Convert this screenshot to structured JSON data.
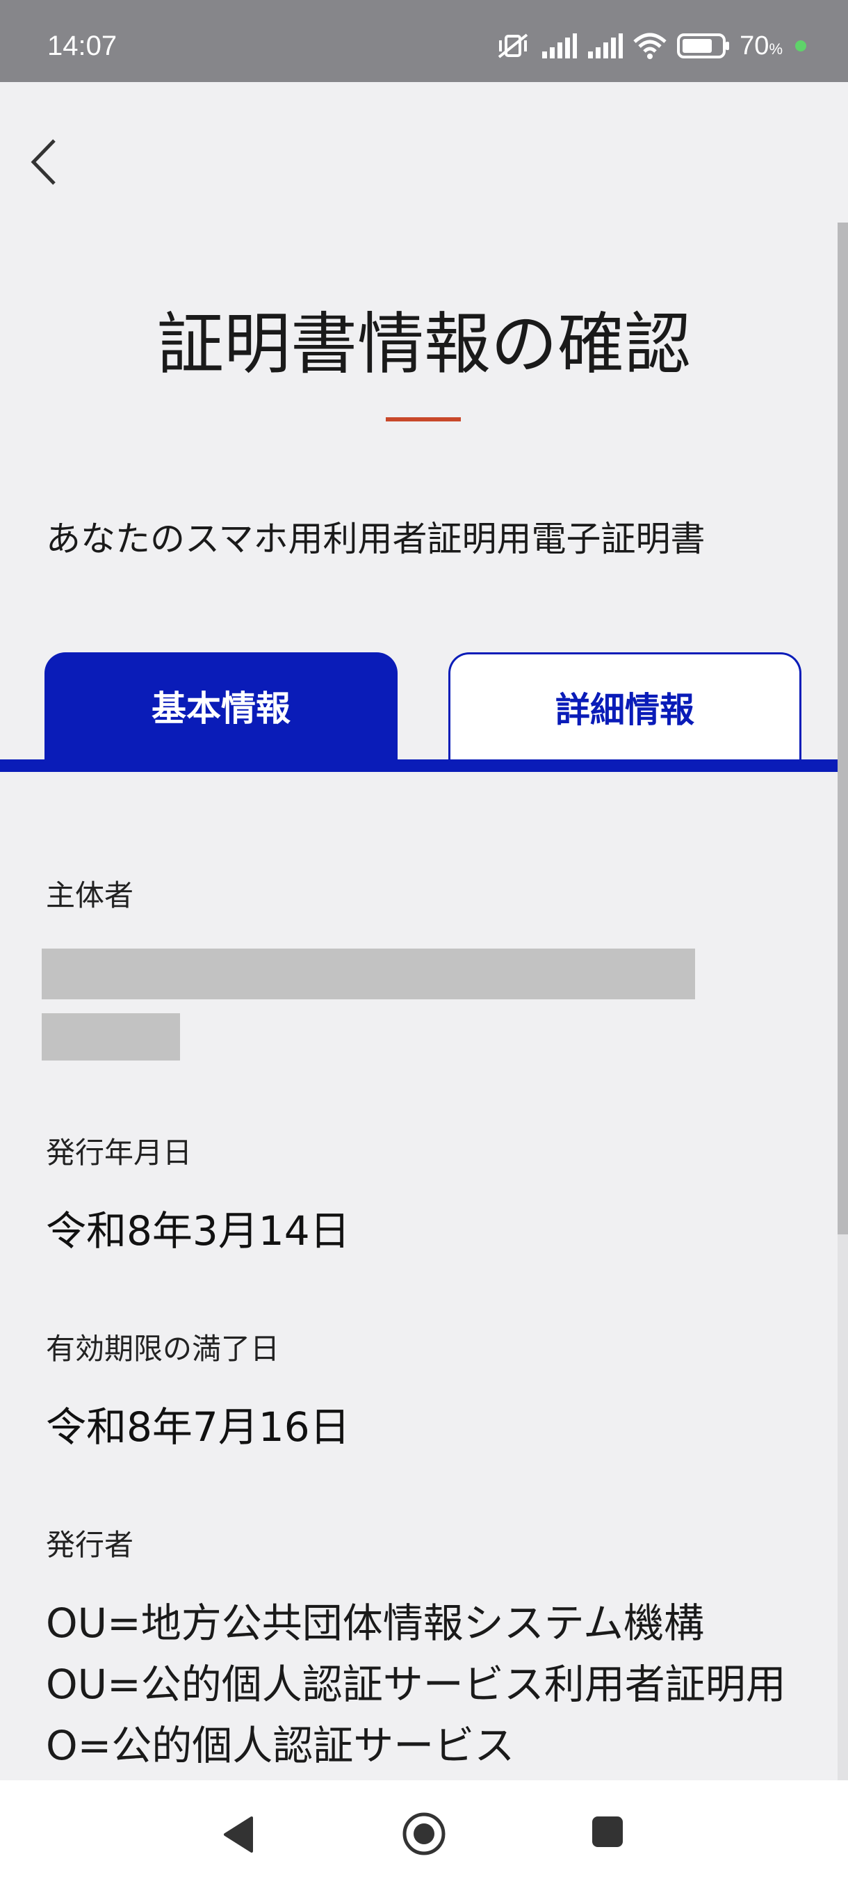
{
  "status_bar": {
    "time": "14:07",
    "battery_percent": "70",
    "battery_unit": "%",
    "icons": [
      "mute-vibrate-icon",
      "signal-icon",
      "signal-icon",
      "wifi-icon",
      "battery-icon",
      "charging-dot-icon"
    ]
  },
  "header": {
    "back_icon": "chevron-left-icon",
    "title": "証明書情報の確認",
    "accent_color": "#c8482a"
  },
  "certificate": {
    "subtitle": "あなたのスマホ用利用者証明用電子証明書"
  },
  "tabs": [
    {
      "label": "基本情報",
      "selected": true
    },
    {
      "label": "詳細情報",
      "selected": false
    }
  ],
  "brand_color": "#0a1cb8",
  "fields": {
    "subject_label": "主体者",
    "issue_date_label": "発行年月日",
    "issue_date": "令和8年3月14日",
    "expiry_label": "有効期限の満了日",
    "expiry_date": "令和8年7月16日",
    "issuer_label": "発行者",
    "issuer_lines": [
      "OU=地方公共団体情報システム機構",
      "OU=公的個人認証サービス利用者証明用",
      "O=公的個人認証サービス"
    ]
  },
  "nav_bar": {
    "icons": [
      "back-triangle-icon",
      "home-circle-icon",
      "recents-square-icon"
    ]
  }
}
